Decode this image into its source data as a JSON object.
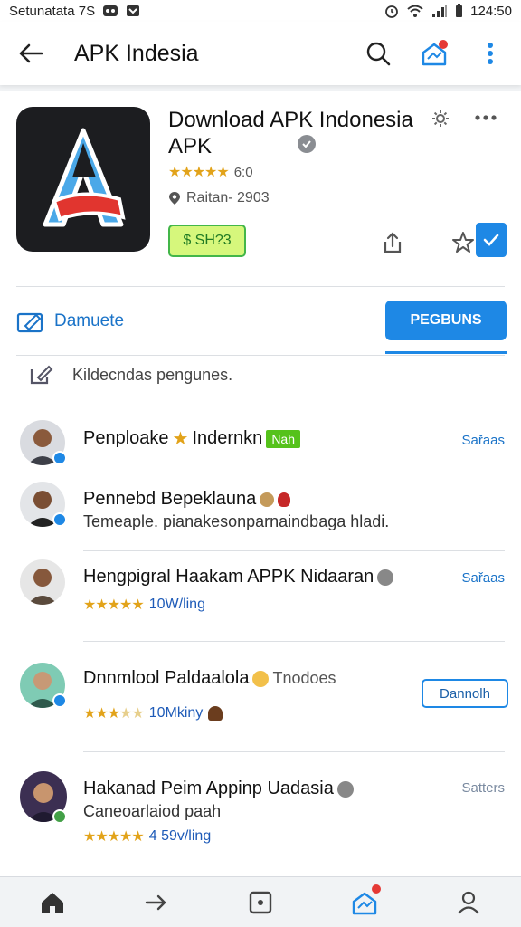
{
  "status_bar": {
    "left_text": "Setunatata 7S",
    "time": "124:50"
  },
  "app_bar": {
    "title": "APK Indesia"
  },
  "app": {
    "title": "Download APK Indonesia APK",
    "rating": "6:0",
    "size_label": "Raitan- 2903",
    "price_label": "$ SH?3"
  },
  "actions": {
    "edit_label": "Damuete",
    "primary_label": "PEGBUNS"
  },
  "hint": "Kildecndas pengunes.",
  "reviews": [
    {
      "name": "Penploake",
      "name_suffix": "Indernkn",
      "tag": "Nah",
      "link": "Sařaas"
    },
    {
      "name": "Pennebd Bepeklauna",
      "text": "Temeaple. pianakesonparnaindbaga hladi."
    },
    {
      "name": "Hengpigral Haakam APPK Nidaaran",
      "meta": "10W/ling",
      "link": "Sařaas"
    },
    {
      "name": "Dnnmlool Paldaalola",
      "name_suffix": "Tnodoes",
      "meta": "10Mkiny",
      "button": "Dannolh"
    },
    {
      "name": "Hakanad Peim Appinp Uadasia",
      "text": "Caneoarlaiod paah",
      "meta": "4 59v/ling",
      "link": "Satters"
    }
  ],
  "colors": {
    "accent": "#1e88e5",
    "star": "#e2a31a",
    "price_bg": "#d6f77c",
    "tag_green": "#55c21b"
  },
  "icons": {
    "back": "arrow-left-icon",
    "search": "search-icon",
    "notifications": "home-badge-icon",
    "more": "more-vert-icon"
  }
}
